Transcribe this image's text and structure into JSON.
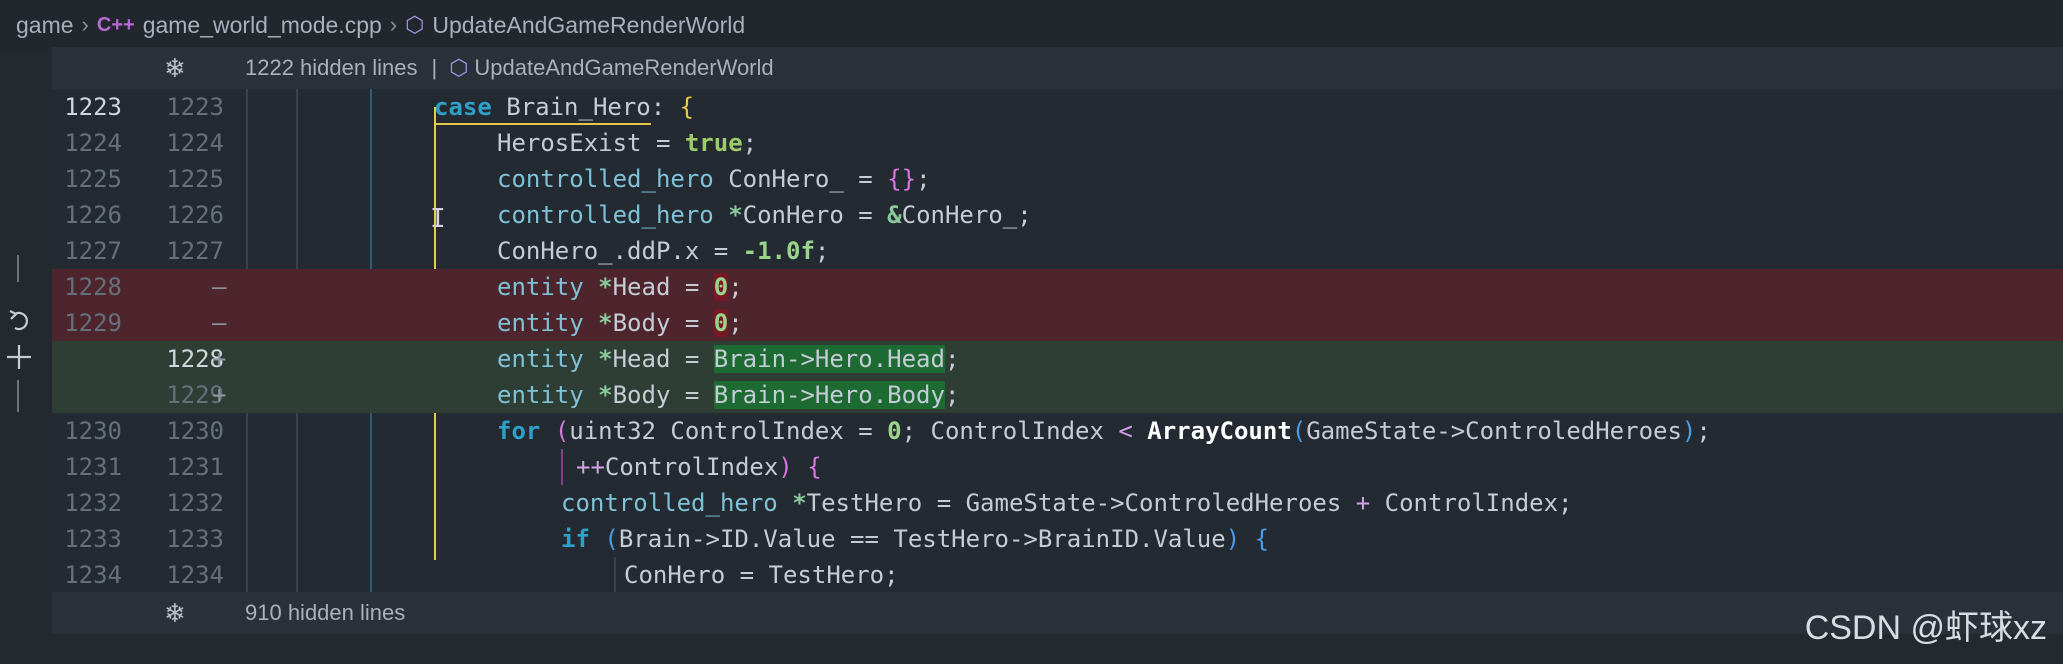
{
  "breadcrumb": {
    "folder": "game",
    "file_icon": "C++",
    "file": "game_world_mode.cpp",
    "symbol": "UpdateAndGameRenderWorld"
  },
  "top_fold": {
    "icon": "fold-icon",
    "text": "1222 hidden lines",
    "separator": "|",
    "symbol": "UpdateAndGameRenderWorld"
  },
  "bottom_fold": {
    "icon": "fold-icon",
    "text": "910 hidden lines"
  },
  "diff_markers": {
    "removed": "—",
    "added": "+"
  },
  "lines": [
    {
      "old": "1223",
      "new": "1223",
      "type": "context"
    },
    {
      "old": "1224",
      "new": "1224",
      "type": "context"
    },
    {
      "old": "1225",
      "new": "1225",
      "type": "context"
    },
    {
      "old": "1226",
      "new": "1226",
      "type": "context"
    },
    {
      "old": "1227",
      "new": "1227",
      "type": "context"
    },
    {
      "old": "1228",
      "new": "",
      "type": "removed"
    },
    {
      "old": "1229",
      "new": "",
      "type": "removed"
    },
    {
      "old": "",
      "new": "1228",
      "type": "added"
    },
    {
      "old": "",
      "new": "1229",
      "type": "added"
    },
    {
      "old": "1230",
      "new": "1230",
      "type": "context"
    },
    {
      "old": "1231",
      "new": "1231",
      "type": "context"
    },
    {
      "old": "1232",
      "new": "1232",
      "type": "context"
    },
    {
      "old": "1233",
      "new": "1233",
      "type": "context"
    },
    {
      "old": "1234",
      "new": "1234",
      "type": "context"
    }
  ],
  "code": {
    "l1_kw": "case",
    "l1_name": "Brain_Hero:",
    "l1_brace": "{",
    "l2_name": "HerosExist",
    "l2_eq": "=",
    "l2_val": "true",
    "l2_end": ";",
    "l3_type": "controlled_hero",
    "l3_name": "ConHero_",
    "l3_eq": "=",
    "l3_val": "{}",
    "l3_end": ";",
    "l4_type": "controlled_hero",
    "l4_star": "*",
    "l4_name": "ConHero",
    "l4_eq": "=",
    "l4_amp": "&",
    "l4_rhs": "ConHero_;",
    "l5_lhs": "ConHero_.ddP.x",
    "l5_eq": "=",
    "l5_val": "-1.0f",
    "l5_end": ";",
    "l6_type": "entity",
    "l6_star": "*",
    "l6_name": "Head",
    "l6_eq": "=",
    "l6_val": "0",
    "l6_end": ";",
    "l7_type": "entity",
    "l7_star": "*",
    "l7_name": "Body",
    "l7_eq": "=",
    "l7_val": "0",
    "l7_end": ";",
    "l8_type": "entity",
    "l8_star": "*",
    "l8_name": "Head",
    "l8_eq": "=",
    "l8_rhs": "Brain->Hero.Head",
    "l8_end": ";",
    "l9_type": "entity",
    "l9_star": "*",
    "l9_name": "Body",
    "l9_eq": "=",
    "l9_rhs": "Brain->Hero.Body",
    "l9_end": ";",
    "l10_kw": "for",
    "l10_open": "(",
    "l10_type": "uint32",
    "l10_a": "ControlIndex",
    "l10_eq": "=",
    "l10_zero": "0",
    "l10_b": "; ControlIndex",
    "l10_lt": "<",
    "l10_fn": "ArrayCount",
    "l10_arg_open": "(",
    "l10_arg": "GameState->ControledHeroes",
    "l10_arg_close": ")",
    "l10_end": ";",
    "l11_op": "++",
    "l11_name": "ControlIndex",
    "l11_close": ")",
    "l11_brace": "{",
    "l12_type": "controlled_hero",
    "l12_star": "*",
    "l12_name": "TestHero",
    "l12_eq": "=",
    "l12_a": "GameState->ControledHeroes",
    "l12_plus": "+",
    "l12_b": "ControlIndex;",
    "l13_kw": "if",
    "l13_open": "(",
    "l13_a": "Brain->ID.Value",
    "l13_eq": "==",
    "l13_b": "TestHero->BrainID.Value",
    "l13_close": ")",
    "l13_brace": "{",
    "l14_name": "ConHero",
    "l14_eq": "=",
    "l14_val": "TestHero;"
  },
  "gutter_icons": [
    "revert-icon",
    "add-icon"
  ],
  "watermark": "CSDN @虾球xz"
}
